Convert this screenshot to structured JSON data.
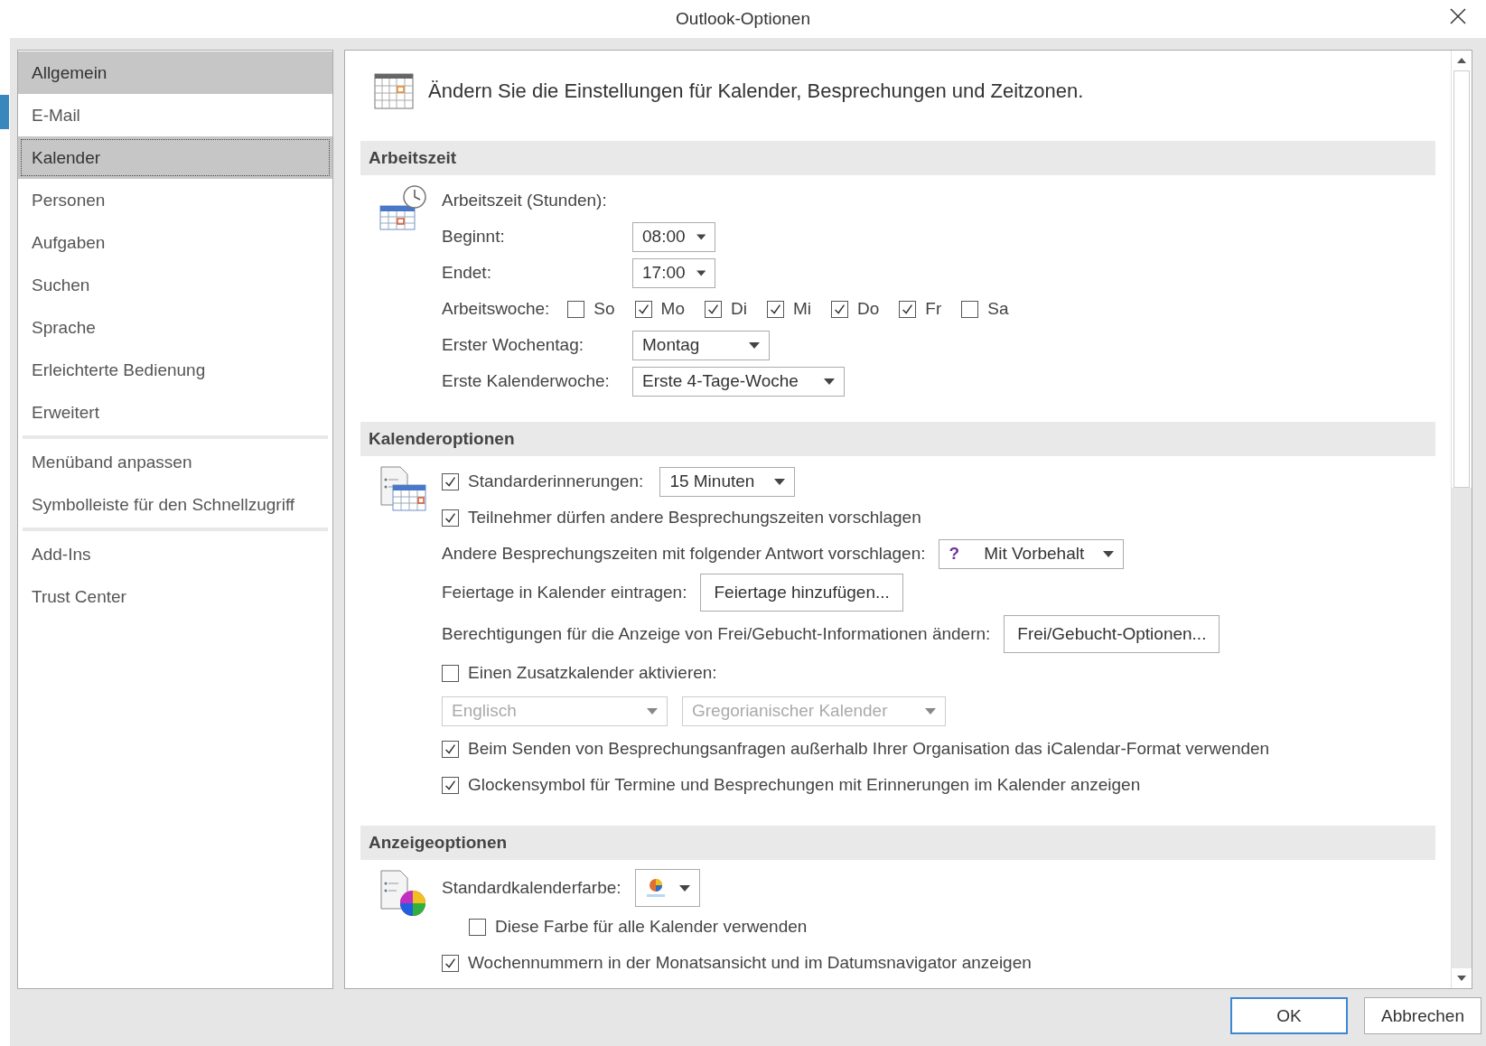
{
  "window": {
    "title": "Outlook-Optionen"
  },
  "sidebar": {
    "groups": [
      [
        {
          "label": "Allgemein",
          "selected": false,
          "hovered": true
        },
        {
          "label": "E-Mail",
          "selected": false,
          "hovered": false
        },
        {
          "label": "Kalender",
          "selected": true,
          "hovered": false
        },
        {
          "label": "Personen",
          "selected": false,
          "hovered": false
        },
        {
          "label": "Aufgaben",
          "selected": false,
          "hovered": false
        },
        {
          "label": "Suchen",
          "selected": false,
          "hovered": false
        },
        {
          "label": "Sprache",
          "selected": false,
          "hovered": false
        },
        {
          "label": "Erleichterte Bedienung",
          "selected": false,
          "hovered": false
        },
        {
          "label": "Erweitert",
          "selected": false,
          "hovered": false
        }
      ],
      [
        {
          "label": "Menüband anpassen",
          "selected": false,
          "hovered": false
        },
        {
          "label": "Symbolleiste für den Schnellzugriff",
          "selected": false,
          "hovered": false
        }
      ],
      [
        {
          "label": "Add-Ins",
          "selected": false,
          "hovered": false
        },
        {
          "label": "Trust Center",
          "selected": false,
          "hovered": false
        }
      ]
    ]
  },
  "content": {
    "heading": "Ändern Sie die Einstellungen für Kalender, Besprechungen und Zeitzonen.",
    "sections": [
      {
        "title": "Arbeitszeit",
        "rows": [
          {
            "kind": "text",
            "label": "Arbeitszeit (Stunden):"
          },
          {
            "kind": "dropdown",
            "label": "Beginnt:",
            "value": "08:00",
            "disabled": false
          },
          {
            "kind": "dropdown",
            "label": "Endet:",
            "value": "17:00",
            "disabled": false
          },
          {
            "kind": "weekdays",
            "label": "Arbeitswoche:",
            "days": [
              {
                "label": "So",
                "checked": false
              },
              {
                "label": "Mo",
                "checked": true
              },
              {
                "label": "Di",
                "checked": true
              },
              {
                "label": "Mi",
                "checked": true
              },
              {
                "label": "Do",
                "checked": true
              },
              {
                "label": "Fr",
                "checked": true
              },
              {
                "label": "Sa",
                "checked": false
              }
            ]
          },
          {
            "kind": "dropdown",
            "label": "Erster Wochentag:",
            "value": "Montag",
            "disabled": false
          },
          {
            "kind": "dropdown",
            "label": "Erste Kalenderwoche:",
            "value": "Erste 4-Tage-Woche",
            "disabled": false
          }
        ]
      },
      {
        "title": "Kalenderoptionen",
        "rows": [
          {
            "kind": "checkbox",
            "label": "Standarderinnerungen:",
            "checked": true,
            "value": "15 Minuten"
          },
          {
            "kind": "checkbox",
            "label": "Teilnehmer dürfen andere Besprechungszeiten vorschlagen",
            "checked": true
          },
          {
            "kind": "response",
            "label": "Andere Besprechungszeiten mit folgender Antwort vorschlagen:",
            "icon": "?",
            "value": "Mit Vorbehalt"
          },
          {
            "kind": "button",
            "label": "Feiertage in Kalender eintragen:",
            "button": "Feiertage hinzufügen..."
          },
          {
            "kind": "button",
            "label": "Berechtigungen für die Anzeige von Frei/Gebucht-Informationen ändern:",
            "button": "Frei/Gebucht-Optionen..."
          },
          {
            "kind": "checkbox",
            "label": "Einen Zusatzkalender aktivieren:",
            "checked": false
          },
          {
            "kind": "dropdowns",
            "items": [
              {
                "value": "Englisch",
                "disabled": true
              },
              {
                "value": "Gregorianischer Kalender",
                "disabled": true
              }
            ]
          },
          {
            "kind": "checkbox",
            "label": "Beim Senden von Besprechungsanfragen außerhalb Ihrer Organisation das iCalendar-Format verwenden",
            "checked": true
          },
          {
            "kind": "checkbox",
            "label": "Glockensymbol für Termine und Besprechungen mit Erinnerungen im Kalender anzeigen",
            "checked": true
          }
        ]
      },
      {
        "title": "Anzeigeoptionen",
        "rows": [
          {
            "kind": "color",
            "label": "Standardkalenderfarbe:"
          },
          {
            "kind": "checkbox",
            "label": "Diese Farbe für alle Kalender verwenden",
            "checked": false,
            "indent": true
          },
          {
            "kind": "checkbox",
            "label": "Wochennummern in der Monatsansicht und im Datumsnavigator anzeigen",
            "checked": true
          }
        ]
      }
    ]
  },
  "buttons": [
    {
      "label": "OK",
      "default": true
    },
    {
      "label": "Abbrechen",
      "default": false
    }
  ]
}
